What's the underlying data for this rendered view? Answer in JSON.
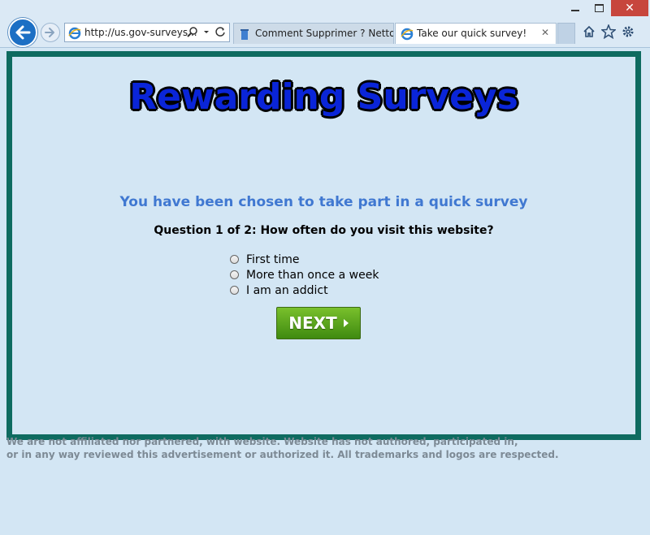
{
  "browser": {
    "address": "http://us.gov-surveys...",
    "tabs": [
      {
        "title": "Comment Supprimer ? Nettoy..."
      },
      {
        "title": "Take our quick survey!"
      }
    ]
  },
  "page": {
    "logo_text": "Rewarding Surveys",
    "headline": "You have been chosen to take part in a quick survey",
    "question": "Question 1 of 2: How often do you visit this website?",
    "options": [
      "First time",
      "More than once a week",
      "I am an addict"
    ],
    "next_label": "NEXT",
    "disclaimer_line1": "We are not affiliated nor partnered, with website. Website has not authored, participated in,",
    "disclaimer_line2": "or in any way reviewed this advertisement or authorized it. All trademarks and logos are respected."
  },
  "colors": {
    "panel_border": "#0e6b60",
    "background": "#d3e6f4",
    "logo_blue": "#0a25d8",
    "headline_blue": "#4078d1",
    "next_green": "#5aa51d"
  }
}
